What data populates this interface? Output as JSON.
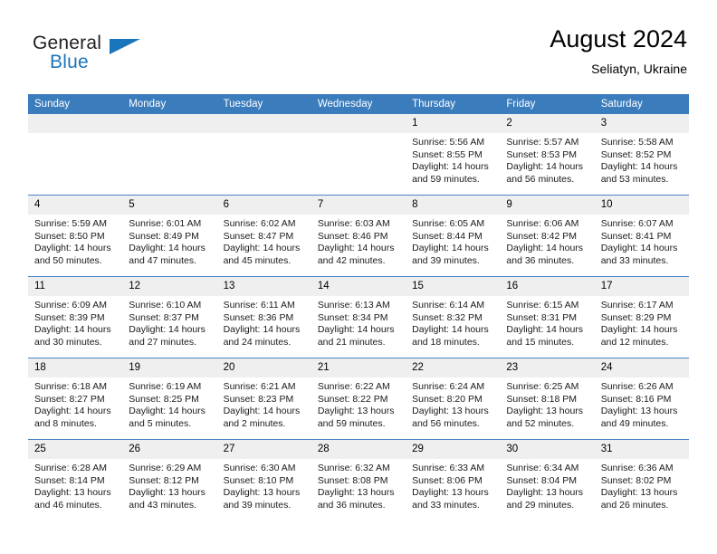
{
  "logo": {
    "word1": "General",
    "word2": "Blue",
    "triangle_color": "#1b75bb",
    "text_color": "#231f20"
  },
  "header": {
    "title": "August 2024",
    "subtitle": "Seliatyn, Ukraine",
    "header_bg": "#3b7cbd",
    "daynum_bg": "#efefef"
  },
  "weekdays": [
    "Sunday",
    "Monday",
    "Tuesday",
    "Wednesday",
    "Thursday",
    "Friday",
    "Saturday"
  ],
  "weeks": [
    [
      {
        "day": "",
        "sunrise": "",
        "sunset": "",
        "daylight1": "",
        "daylight2": "",
        "empty": true
      },
      {
        "day": "",
        "sunrise": "",
        "sunset": "",
        "daylight1": "",
        "daylight2": "",
        "empty": true
      },
      {
        "day": "",
        "sunrise": "",
        "sunset": "",
        "daylight1": "",
        "daylight2": "",
        "empty": true
      },
      {
        "day": "",
        "sunrise": "",
        "sunset": "",
        "daylight1": "",
        "daylight2": "",
        "empty": true
      },
      {
        "day": "1",
        "sunrise": "Sunrise: 5:56 AM",
        "sunset": "Sunset: 8:55 PM",
        "daylight1": "Daylight: 14 hours",
        "daylight2": "and 59 minutes."
      },
      {
        "day": "2",
        "sunrise": "Sunrise: 5:57 AM",
        "sunset": "Sunset: 8:53 PM",
        "daylight1": "Daylight: 14 hours",
        "daylight2": "and 56 minutes."
      },
      {
        "day": "3",
        "sunrise": "Sunrise: 5:58 AM",
        "sunset": "Sunset: 8:52 PM",
        "daylight1": "Daylight: 14 hours",
        "daylight2": "and 53 minutes."
      }
    ],
    [
      {
        "day": "4",
        "sunrise": "Sunrise: 5:59 AM",
        "sunset": "Sunset: 8:50 PM",
        "daylight1": "Daylight: 14 hours",
        "daylight2": "and 50 minutes."
      },
      {
        "day": "5",
        "sunrise": "Sunrise: 6:01 AM",
        "sunset": "Sunset: 8:49 PM",
        "daylight1": "Daylight: 14 hours",
        "daylight2": "and 47 minutes."
      },
      {
        "day": "6",
        "sunrise": "Sunrise: 6:02 AM",
        "sunset": "Sunset: 8:47 PM",
        "daylight1": "Daylight: 14 hours",
        "daylight2": "and 45 minutes."
      },
      {
        "day": "7",
        "sunrise": "Sunrise: 6:03 AM",
        "sunset": "Sunset: 8:46 PM",
        "daylight1": "Daylight: 14 hours",
        "daylight2": "and 42 minutes."
      },
      {
        "day": "8",
        "sunrise": "Sunrise: 6:05 AM",
        "sunset": "Sunset: 8:44 PM",
        "daylight1": "Daylight: 14 hours",
        "daylight2": "and 39 minutes."
      },
      {
        "day": "9",
        "sunrise": "Sunrise: 6:06 AM",
        "sunset": "Sunset: 8:42 PM",
        "daylight1": "Daylight: 14 hours",
        "daylight2": "and 36 minutes."
      },
      {
        "day": "10",
        "sunrise": "Sunrise: 6:07 AM",
        "sunset": "Sunset: 8:41 PM",
        "daylight1": "Daylight: 14 hours",
        "daylight2": "and 33 minutes."
      }
    ],
    [
      {
        "day": "11",
        "sunrise": "Sunrise: 6:09 AM",
        "sunset": "Sunset: 8:39 PM",
        "daylight1": "Daylight: 14 hours",
        "daylight2": "and 30 minutes."
      },
      {
        "day": "12",
        "sunrise": "Sunrise: 6:10 AM",
        "sunset": "Sunset: 8:37 PM",
        "daylight1": "Daylight: 14 hours",
        "daylight2": "and 27 minutes."
      },
      {
        "day": "13",
        "sunrise": "Sunrise: 6:11 AM",
        "sunset": "Sunset: 8:36 PM",
        "daylight1": "Daylight: 14 hours",
        "daylight2": "and 24 minutes."
      },
      {
        "day": "14",
        "sunrise": "Sunrise: 6:13 AM",
        "sunset": "Sunset: 8:34 PM",
        "daylight1": "Daylight: 14 hours",
        "daylight2": "and 21 minutes."
      },
      {
        "day": "15",
        "sunrise": "Sunrise: 6:14 AM",
        "sunset": "Sunset: 8:32 PM",
        "daylight1": "Daylight: 14 hours",
        "daylight2": "and 18 minutes."
      },
      {
        "day": "16",
        "sunrise": "Sunrise: 6:15 AM",
        "sunset": "Sunset: 8:31 PM",
        "daylight1": "Daylight: 14 hours",
        "daylight2": "and 15 minutes."
      },
      {
        "day": "17",
        "sunrise": "Sunrise: 6:17 AM",
        "sunset": "Sunset: 8:29 PM",
        "daylight1": "Daylight: 14 hours",
        "daylight2": "and 12 minutes."
      }
    ],
    [
      {
        "day": "18",
        "sunrise": "Sunrise: 6:18 AM",
        "sunset": "Sunset: 8:27 PM",
        "daylight1": "Daylight: 14 hours",
        "daylight2": "and 8 minutes."
      },
      {
        "day": "19",
        "sunrise": "Sunrise: 6:19 AM",
        "sunset": "Sunset: 8:25 PM",
        "daylight1": "Daylight: 14 hours",
        "daylight2": "and 5 minutes."
      },
      {
        "day": "20",
        "sunrise": "Sunrise: 6:21 AM",
        "sunset": "Sunset: 8:23 PM",
        "daylight1": "Daylight: 14 hours",
        "daylight2": "and 2 minutes."
      },
      {
        "day": "21",
        "sunrise": "Sunrise: 6:22 AM",
        "sunset": "Sunset: 8:22 PM",
        "daylight1": "Daylight: 13 hours",
        "daylight2": "and 59 minutes."
      },
      {
        "day": "22",
        "sunrise": "Sunrise: 6:24 AM",
        "sunset": "Sunset: 8:20 PM",
        "daylight1": "Daylight: 13 hours",
        "daylight2": "and 56 minutes."
      },
      {
        "day": "23",
        "sunrise": "Sunrise: 6:25 AM",
        "sunset": "Sunset: 8:18 PM",
        "daylight1": "Daylight: 13 hours",
        "daylight2": "and 52 minutes."
      },
      {
        "day": "24",
        "sunrise": "Sunrise: 6:26 AM",
        "sunset": "Sunset: 8:16 PM",
        "daylight1": "Daylight: 13 hours",
        "daylight2": "and 49 minutes."
      }
    ],
    [
      {
        "day": "25",
        "sunrise": "Sunrise: 6:28 AM",
        "sunset": "Sunset: 8:14 PM",
        "daylight1": "Daylight: 13 hours",
        "daylight2": "and 46 minutes."
      },
      {
        "day": "26",
        "sunrise": "Sunrise: 6:29 AM",
        "sunset": "Sunset: 8:12 PM",
        "daylight1": "Daylight: 13 hours",
        "daylight2": "and 43 minutes."
      },
      {
        "day": "27",
        "sunrise": "Sunrise: 6:30 AM",
        "sunset": "Sunset: 8:10 PM",
        "daylight1": "Daylight: 13 hours",
        "daylight2": "and 39 minutes."
      },
      {
        "day": "28",
        "sunrise": "Sunrise: 6:32 AM",
        "sunset": "Sunset: 8:08 PM",
        "daylight1": "Daylight: 13 hours",
        "daylight2": "and 36 minutes."
      },
      {
        "day": "29",
        "sunrise": "Sunrise: 6:33 AM",
        "sunset": "Sunset: 8:06 PM",
        "daylight1": "Daylight: 13 hours",
        "daylight2": "and 33 minutes."
      },
      {
        "day": "30",
        "sunrise": "Sunrise: 6:34 AM",
        "sunset": "Sunset: 8:04 PM",
        "daylight1": "Daylight: 13 hours",
        "daylight2": "and 29 minutes."
      },
      {
        "day": "31",
        "sunrise": "Sunrise: 6:36 AM",
        "sunset": "Sunset: 8:02 PM",
        "daylight1": "Daylight: 13 hours",
        "daylight2": "and 26 minutes."
      }
    ]
  ]
}
